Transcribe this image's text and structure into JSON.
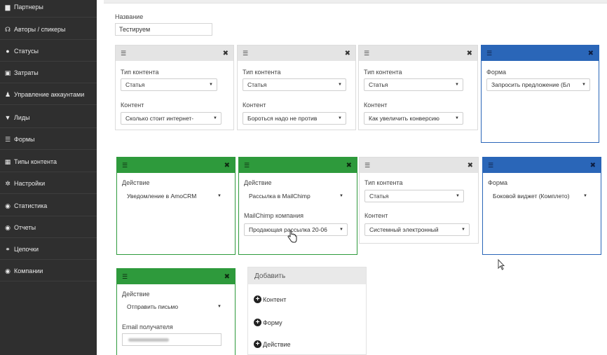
{
  "sidebar": {
    "items": [
      {
        "label": "Партнеры",
        "icon": "briefcase-icon",
        "glyph": "▆"
      },
      {
        "label": "Авторы / спикеры",
        "icon": "headphones-icon",
        "glyph": "☊"
      },
      {
        "label": "Статусы",
        "icon": "info-icon",
        "glyph": "●"
      },
      {
        "label": "Затраты",
        "icon": "money-icon",
        "glyph": "▣"
      },
      {
        "label": "Управление аккаунтами",
        "icon": "users-icon",
        "glyph": "♟"
      },
      {
        "label": "Лиды",
        "icon": "filter-icon",
        "glyph": "▼"
      },
      {
        "label": "Формы",
        "icon": "list-icon",
        "glyph": "☰"
      },
      {
        "label": "Типы контента",
        "icon": "grid-icon",
        "glyph": "▦"
      },
      {
        "label": "Настройки",
        "icon": "gears-icon",
        "glyph": "✲"
      },
      {
        "label": "Статистика",
        "icon": "dashboard-icon",
        "glyph": "◉"
      },
      {
        "label": "Отчеты",
        "icon": "dashboard-icon",
        "glyph": "◉"
      },
      {
        "label": "Цепочки",
        "icon": "sitemap-icon",
        "glyph": "⚭"
      },
      {
        "label": "Компании",
        "icon": "dashboard-icon",
        "glyph": "◉"
      }
    ]
  },
  "form": {
    "name_label": "Название",
    "name_value": "Тестируем"
  },
  "cards": {
    "c1": {
      "label1": "Тип контента",
      "value1": "Статья",
      "label2": "Контент",
      "value2": "Сколько стоит интернет-"
    },
    "c2": {
      "label1": "Тип контента",
      "value1": "Статья",
      "label2": "Контент",
      "value2": "Бороться надо не против"
    },
    "c3": {
      "label1": "Тип контента",
      "value1": "Статья",
      "label2": "Контент",
      "value2": "Как увеличить конверсию"
    },
    "c4": {
      "label1": "Форма",
      "value1": "Запросить предложение (Бл"
    },
    "c5": {
      "label1": "Действие",
      "value1": "Уведомление в AmoCRM"
    },
    "c6": {
      "label1": "Действие",
      "value1": "Рассылка в MailChimp",
      "label2": "MailChimp компания",
      "value2": "Продающая рассылка 20-06"
    },
    "c7": {
      "label1": "Тип контента",
      "value1": "Статья",
      "label2": "Контент",
      "value2": "Системный электронный"
    },
    "c8": {
      "label1": "Форма",
      "value1": "Боковой виджет (Комплето)"
    },
    "c9": {
      "label1": "Действие",
      "value1": "Отправить письмо",
      "label2": "Email получателя"
    }
  },
  "add_panel": {
    "title": "Добавить",
    "items": [
      "Контент",
      "Форму",
      "Действие"
    ]
  },
  "colors": {
    "sidebar_bg": "#2f2f2f",
    "action_green": "#2e9a3c",
    "form_blue": "#2a66b8",
    "content_gray": "#e4e4e4"
  }
}
